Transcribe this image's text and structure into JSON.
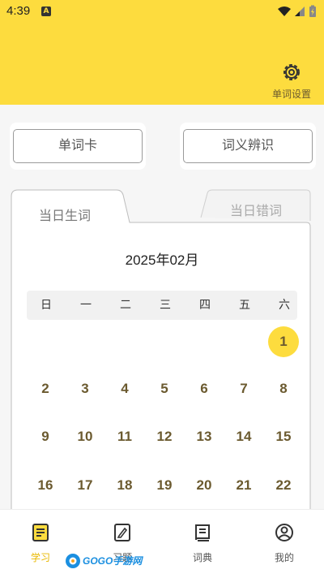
{
  "status_bar": {
    "time": "4:39",
    "notification_badge": "A"
  },
  "header": {
    "settings_label": "单词设置",
    "settings_icon": "gear-icon"
  },
  "actions": {
    "word_card": "单词卡",
    "word_meaning": "词义辨识"
  },
  "tabs": [
    {
      "label": "当日生词",
      "active": true
    },
    {
      "label": "当日错词",
      "active": false
    }
  ],
  "calendar": {
    "month_title": "2025年02月",
    "weekdays": [
      "日",
      "一",
      "二",
      "三",
      "四",
      "五",
      "六"
    ],
    "selected_day": "1",
    "rows": [
      [
        "",
        "",
        "",
        "",
        "",
        "",
        "1"
      ],
      [
        "2",
        "3",
        "4",
        "5",
        "6",
        "7",
        "8"
      ],
      [
        "9",
        "10",
        "11",
        "12",
        "13",
        "14",
        "15"
      ],
      [
        "16",
        "17",
        "18",
        "19",
        "20",
        "21",
        "22"
      ]
    ]
  },
  "colors": {
    "accent": "#fddc3e",
    "day_text": "#6b5a2f",
    "active_nav": "#e9b800"
  },
  "bottom_nav": [
    {
      "label": "学习",
      "icon": "study-icon",
      "active": true
    },
    {
      "label": "习题",
      "icon": "exercise-icon",
      "active": false
    },
    {
      "label": "词典",
      "icon": "dictionary-icon",
      "active": false
    },
    {
      "label": "我的",
      "icon": "profile-icon",
      "active": false
    }
  ],
  "watermark": {
    "text": "GOGO手游网"
  }
}
